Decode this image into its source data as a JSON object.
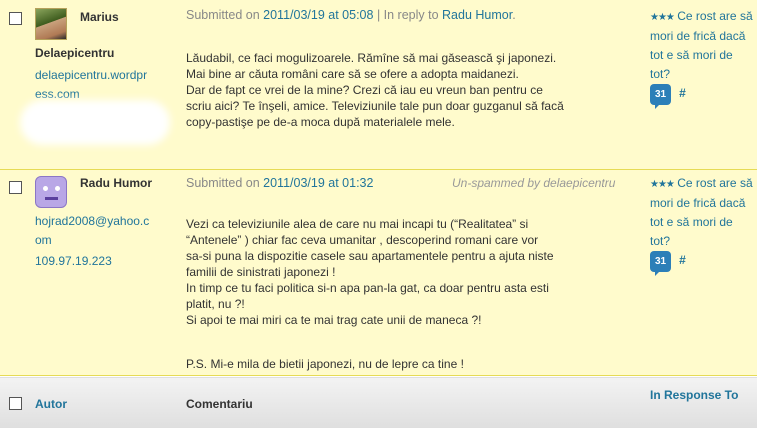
{
  "comments": [
    {
      "author": "Marius",
      "author_sub": "Delaepicentru",
      "url": "delaepicentru.wordpress.com",
      "url_line1": "delaepicentru.wordpr",
      "url_line2": "ess.com",
      "submitted_label": "Submitted on",
      "date": "2011/03/19 at 05:08",
      "reply_sep": "| In reply to",
      "reply_to": "Radu Humor",
      "reply_end": ".",
      "paragraphs": [
        "Lăudabil, ce faci mogulizoarele. Rămîne să mai găsească şi japonezi.\nMai bine ar căuta români care să se ofere a adopta maidanezi.\nDar de fapt ce vrei de la mine? Crezi că iau eu vreun ban pentru ce\nscriu aici? Te înşeli, amice. Televiziunile tale pun doar guzganul să facă\ncopy-pastişe pe de-a moca după materialele mele."
      ],
      "in_response": {
        "stars": "★★★",
        "post_title": "Ce rost are să mori de frică dacă tot e să mori de tot?",
        "count": "31",
        "hash": "#"
      }
    },
    {
      "author": "Radu Humor",
      "email_line1": "hojrad2008@yahoo.c",
      "email_line2": "om",
      "ip": "109.97.19.223",
      "submitted_label": "Submitted on",
      "date": "2011/03/19 at 01:32",
      "status": "Un-spammed by delaepicentru",
      "paragraphs": [
        "Vezi ca televiziunile alea de care nu mai incapi tu (“Realitatea” si\n“Antenele” ) chiar fac ceva umanitar , descoperind romani care vor\nsa-si puna la dispozitie casele sau apartamentele pentru a ajuta niste\nfamilii de sinistrati japonezi !\nIn timp ce tu faci politica si-n apa pan-la gat, ca doar pentru asta esti\nplatit, nu ?!\nSi apoi te mai miri ca te mai trag cate unii de maneca ?!",
        "P.S. Mi-e mila de bietii japonezi, nu de lepre ca tine !"
      ],
      "in_response": {
        "stars": "★★★",
        "post_title": "Ce rost are să mori de frică dacă tot e să mori de tot?",
        "count": "31",
        "hash": "#"
      }
    }
  ],
  "footer": {
    "author_col": "Autor",
    "comment_col": "Comentariu",
    "response_col": "In Response To"
  }
}
